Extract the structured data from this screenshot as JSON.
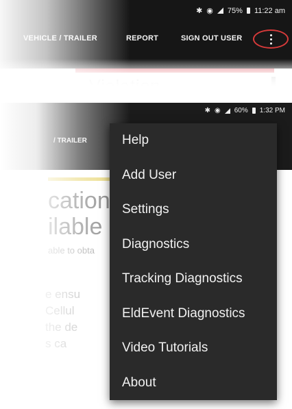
{
  "top_shot": {
    "status": {
      "time": "11:22 am",
      "battery": "75%"
    },
    "tabs": [
      "VEHICLE / TRAILER",
      "REPORT",
      "SIGN OUT USER"
    ],
    "heading": "Violation"
  },
  "bottom_shot": {
    "status": {
      "time": "1:32 PM",
      "battery": "60%"
    },
    "tab": "/ TRAILER",
    "heading_lines": [
      "cation",
      "ilable"
    ],
    "sub_text": "able to obta",
    "paragraph_lines": [
      "e ensu",
      "Cellul",
      "the de",
      "s ca"
    ],
    "menu_items": [
      "Help",
      "Add User",
      "Settings",
      "Diagnostics",
      "Tracking Diagnostics",
      "EldEvent Diagnostics",
      "Video Tutorials",
      "About"
    ]
  },
  "colors": {
    "app_bar": "#161616",
    "menu_bg": "#2a2a2a",
    "highlight_circle": "#d63a3a",
    "pink_bar": "#e67b84",
    "yellow_bar": "#e9d87a"
  }
}
